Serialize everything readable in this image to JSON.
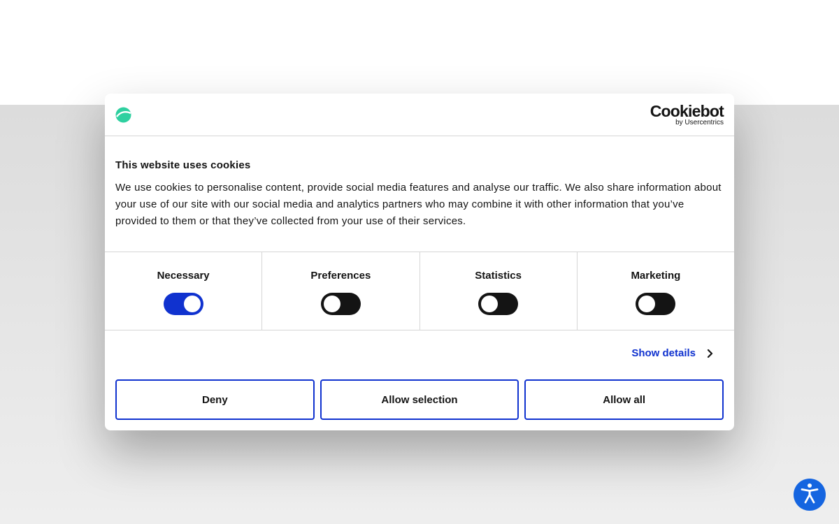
{
  "dialog": {
    "brand_logo_icon": "cookiebot-leaf-icon",
    "cookiebot_logo": {
      "name": "Cookiebot",
      "by": "by Usercentrics"
    },
    "title": "This website uses cookies",
    "text": "We use cookies to personalise content, provide social media features and analyse our traffic. We also share information about your use of our site with our social media and analytics partners who may combine it with other information that you’ve provided to them or that they’ve collected from your use of their services.",
    "categories": [
      {
        "label": "Necessary",
        "checked": true
      },
      {
        "label": "Preferences",
        "checked": false
      },
      {
        "label": "Statistics",
        "checked": false
      },
      {
        "label": "Marketing",
        "checked": false
      }
    ],
    "show_details": "Show details",
    "buttons": {
      "deny": "Deny",
      "allow_selection": "Allow selection",
      "allow_all": "Allow all"
    }
  },
  "accessibility_button": {
    "icon": "accessibility-person-icon"
  },
  "colors": {
    "accent": "#1032cf",
    "toggle_off": "#141414",
    "brand_green": "#2fd0a0",
    "accessibility_blue": "#1565e0"
  }
}
